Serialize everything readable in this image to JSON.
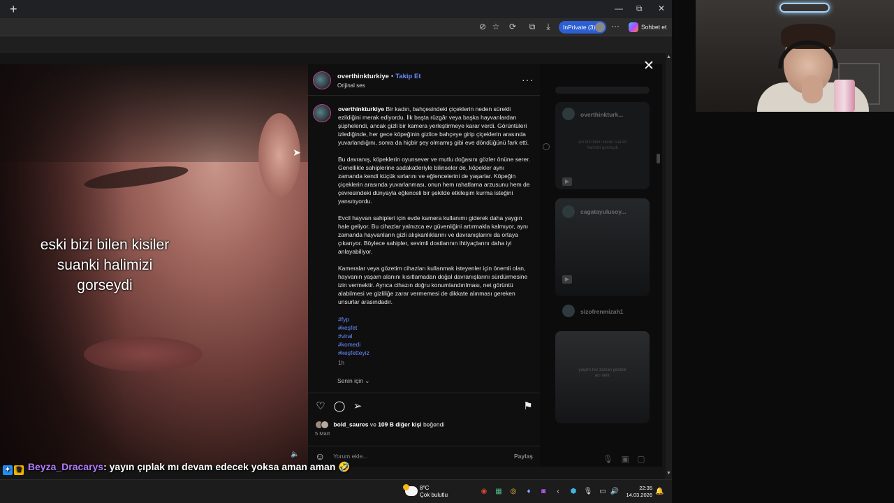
{
  "browser": {
    "newtab_glyph": "+",
    "window_controls": [
      "—",
      "⧉",
      "✕"
    ],
    "inprivate_label": "InPrivate (3)",
    "chat_label": "Sohbet et"
  },
  "video": {
    "caption_lines": [
      "eski bizi bilen kisiler",
      "suanki halimizi",
      "gorseydi"
    ],
    "volume_glyph": "🔈"
  },
  "post": {
    "username": "overthinkturkiye",
    "separator": "•",
    "follow_label": "Takip Et",
    "audio_label": "Orijinal ses",
    "more_glyph": "···",
    "caption_user": "overthinkturkiye",
    "caption_paragraphs": [
      "Bir kadın, bahçesindeki çiçeklerin neden sürekli ezildiğini merak ediyordu. İlk başta rüzgâr veya başka hayvanlardan şüphelendi, ancak gizli bir kamera yerleştirmeye karar verdi. Görüntüleri izlediğinde, her gece köpeğinin gizlice bahçeye girip çiçeklerin arasında yuvarlandığını, sonra da hiçbir şey olmamış gibi eve döndüğünü fark etti.",
      "Bu davranış, köpeklerin oyunsever ve mutlu doğasını gözler önüne serer. Genellikle sahiplerine sadakatleriyle bilinseler de, köpekler aynı zamanda kendi küçük sırlarını ve eğlencelerini de yaşarlar. Köpeğin çiçeklerin arasında yuvarlanması, onun hem rahatlama arzusunu hem de çevresindeki dünyayla eğlenceli bir şekilde etkileşim kurma isteğini yansıtıyordu.",
      "Evcil hayvan sahipleri için evde kamera kullanımı giderek daha yaygın hale geliyor. Bu cihazlar yalnızca ev güvenliğini artırmakla kalmıyor, aynı zamanda hayvanların gizli alışkanlıklarını ve davranışlarını da ortaya çıkarıyor. Böylece sahipler, sevimli dostlarının ihtiyaçlarını daha iyi anlayabiliyor.",
      "Kameralar veya gözetim cihazları kullanmak isteyenler için önemli olan, hayvanın yaşam alanını kısıtlamadan doğal davranışlarını sürdürmesine izin vermektir. Ayrıca cihazın doğru konumlandırılması, net görüntü alabilmesi ve gizliliğe zarar vermemesi de dikkate alınması gereken unsurlar arasındadır."
    ],
    "hashtags": [
      "#fyp",
      "#keşfet",
      "#viral",
      "#komedi",
      "#keşfetteyiz"
    ],
    "time_ago": "1h",
    "for_you": "Senin için ⌄",
    "likes_user": "bold_saures",
    "likes_mid": "ve",
    "likes_count": "109 B diğer kişi",
    "likes_tail": "beğendi",
    "date": "5 Mart",
    "comment_placeholder": "Yorum ekle...",
    "share_label": "Paylaş"
  },
  "sidebar": {
    "cards": [
      {
        "name": "overthinkturk...",
        "small": "adı bizi bilen kisiler suanki halimizi gorseydi"
      },
      {
        "name": "cagatayulusoy..."
      },
      {
        "name": "sizofrenmizah1"
      },
      {
        "small": "yaşam her zaman genelik acı verir"
      }
    ],
    "close_glyph": "✕"
  },
  "chat": {
    "username": "Beyza_Dracarys",
    "message": ": yayın çıplak mı devam edecek yoksa aman aman 🤣"
  },
  "taskbar": {
    "temp": "8°C",
    "weather": "Çok bulutlu",
    "time": "22:35",
    "date": "14.03.2026"
  }
}
